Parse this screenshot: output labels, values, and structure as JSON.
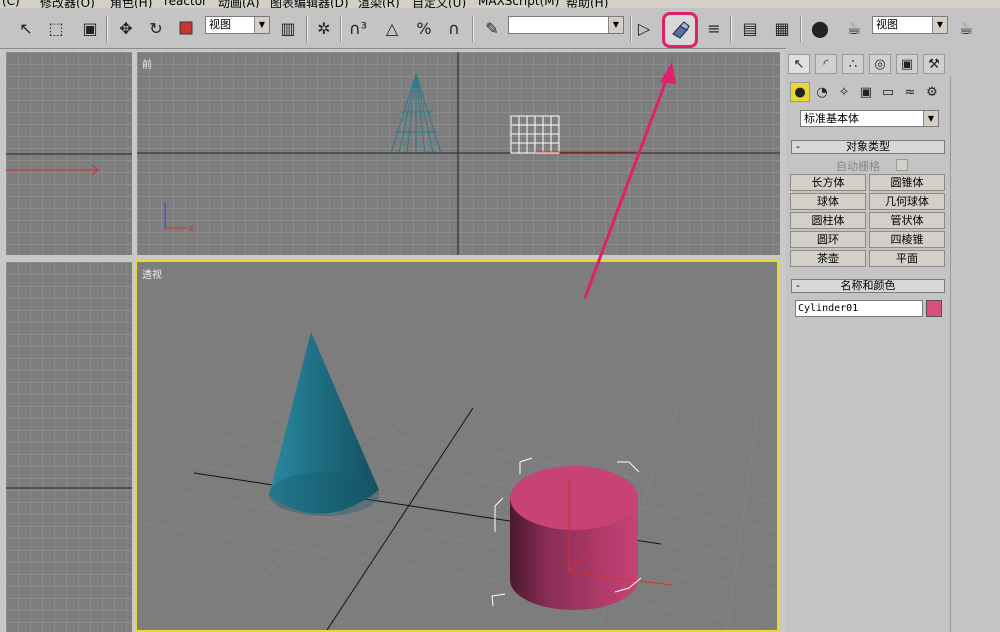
{
  "menu": {
    "items": [
      "(C)",
      "修改器(O)",
      "角色(H)",
      "reactor",
      "动画(A)",
      "图表编辑器(D)",
      "渲染(R)",
      "自定义(U)",
      "MAXScript(M)",
      "帮助(H)"
    ]
  },
  "toolbar": {
    "view_dropdown": "视图",
    "named_sel_dropdown": "",
    "render_view_dropdown": "视图",
    "tooltip": "对齐"
  },
  "viewports": {
    "front_label": "前",
    "perspective_label": "透视"
  },
  "command_panel": {
    "category_dropdown": "标准基本体",
    "object_type": {
      "title": "对象类型",
      "collapse": "-",
      "autogrid_label": "自动栅格",
      "buttons": [
        "长方体",
        "圆锥体",
        "球体",
        "几何球体",
        "圆柱体",
        "管状体",
        "圆环",
        "四棱锥",
        "茶壶",
        "平面"
      ]
    },
    "name_color": {
      "title": "名称和颜色",
      "collapse": "-",
      "name_value": "Cylinder01",
      "color": "#d8507e"
    }
  },
  "colors": {
    "highlight": "#e0206a",
    "active_viewport_border": "#e8d830",
    "cone": "#1f6e82",
    "cylinder": "#c84276"
  },
  "icons": {
    "align_tool": "align-icon"
  }
}
